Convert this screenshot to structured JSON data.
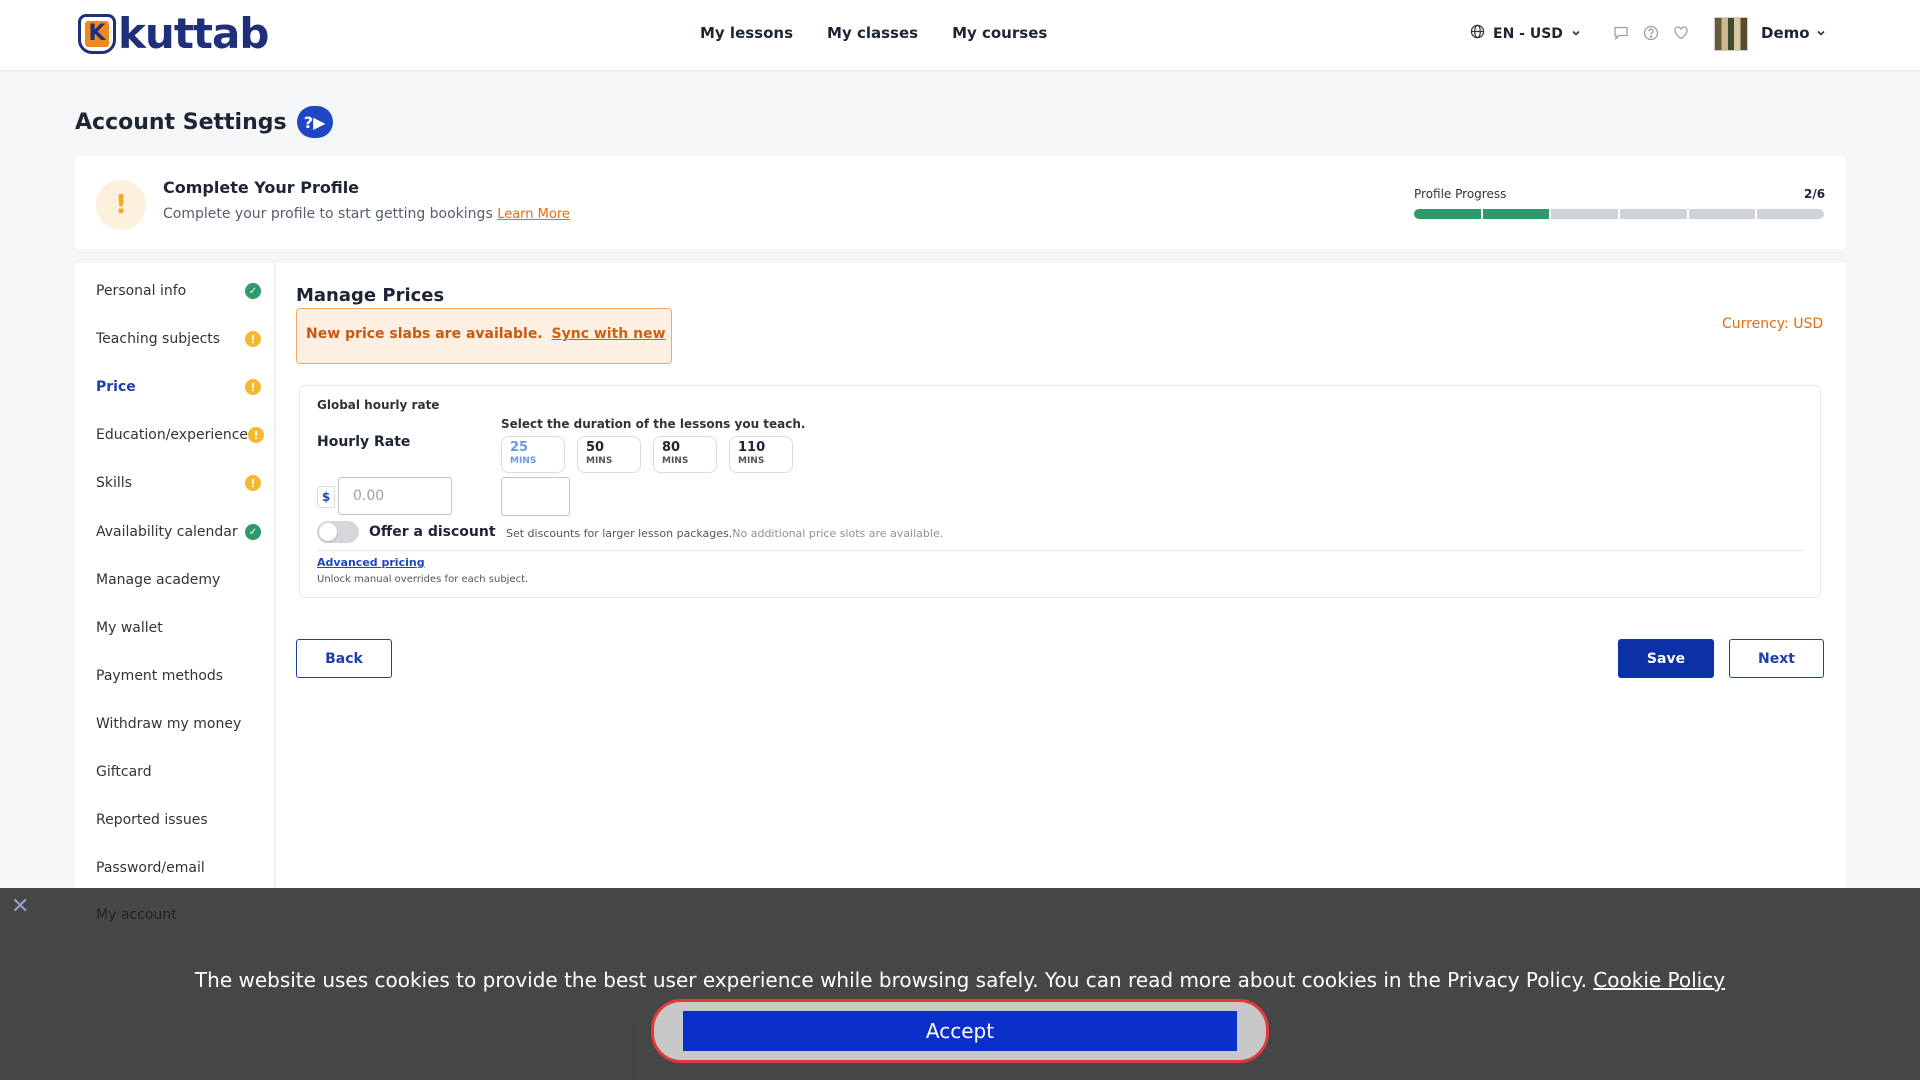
{
  "header": {
    "logo_letter": "K",
    "logo_text": "kuttab",
    "nav": [
      "My lessons",
      "My classes",
      "My courses"
    ],
    "language": "EN - USD",
    "user_name": "Demo"
  },
  "page": {
    "title": "Account Settings",
    "help_badge": "?▶"
  },
  "profile": {
    "title": "Complete Your Profile",
    "subtitle": "Complete your profile to start getting bookings",
    "learn_more": "Learn More",
    "progress_label": "Profile Progress",
    "progress_count": "2/6",
    "steps_done": 2,
    "steps_total": 6
  },
  "sidebar": {
    "items": [
      {
        "label": "Personal info",
        "status": "ok"
      },
      {
        "label": "Teaching subjects",
        "status": "warn"
      },
      {
        "label": "Price",
        "status": "warn"
      },
      {
        "label": "Education/experience",
        "status": "warn"
      },
      {
        "label": "Skills",
        "status": "warn"
      },
      {
        "label": "Availability calendar",
        "status": "ok"
      },
      {
        "label": "Manage academy",
        "status": ""
      },
      {
        "label": "My wallet",
        "status": ""
      },
      {
        "label": "Payment methods",
        "status": ""
      },
      {
        "label": "Withdraw my money",
        "status": ""
      },
      {
        "label": "Giftcard",
        "status": ""
      },
      {
        "label": "Reported issues",
        "status": ""
      },
      {
        "label": "Password/email",
        "status": ""
      },
      {
        "label": "My account",
        "status": ""
      }
    ]
  },
  "main": {
    "title": "Manage Prices",
    "sync_message": "New price slabs are available.",
    "sync_link": "Sync with new",
    "currency": "Currency: USD",
    "global_label": "Global hourly rate",
    "hourly_label": "Hourly Rate",
    "duration_label": "Select the duration of the lessons you teach.",
    "durations": [
      {
        "value": "25",
        "unit": "MINS"
      },
      {
        "value": "50",
        "unit": "MINS"
      },
      {
        "value": "80",
        "unit": "MINS"
      },
      {
        "value": "110",
        "unit": "MINS"
      }
    ],
    "currency_symbol": "$",
    "price_placeholder": "0.00",
    "discount_label": "Offer a discount",
    "discount_hint": "Set discounts for larger lesson packages.",
    "discount_note": "No additional price slots are available.",
    "advanced_link": "Advanced pricing",
    "advanced_sub": "Unlock manual overrides for each subject.",
    "back": "Back",
    "save": "Save",
    "next": "Next"
  },
  "cookie": {
    "close": "✕",
    "text": "The website uses cookies to provide the best user experience while browsing safely. You can read more about cookies in the Privacy Policy.",
    "policy_link": "Cookie Policy",
    "accept": "Accept"
  },
  "colors": {
    "accent": "#0b30a8",
    "success": "#2c9a6b",
    "warning": "#f5b82e",
    "orange": "#e06d10"
  }
}
